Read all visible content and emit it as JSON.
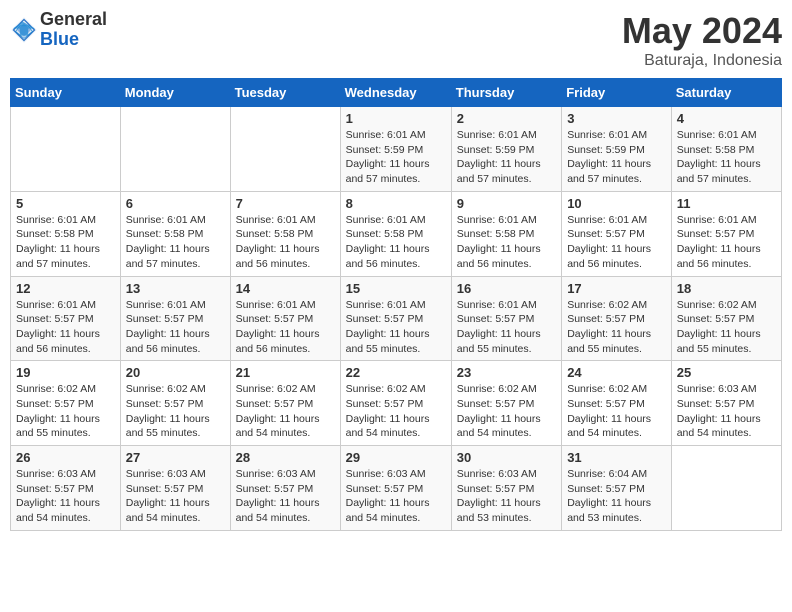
{
  "logo": {
    "general": "General",
    "blue": "Blue"
  },
  "title": "May 2024",
  "location": "Baturaja, Indonesia",
  "weekdays": [
    "Sunday",
    "Monday",
    "Tuesday",
    "Wednesday",
    "Thursday",
    "Friday",
    "Saturday"
  ],
  "weeks": [
    [
      {
        "day": "",
        "info": ""
      },
      {
        "day": "",
        "info": ""
      },
      {
        "day": "",
        "info": ""
      },
      {
        "day": "1",
        "info": "Sunrise: 6:01 AM\nSunset: 5:59 PM\nDaylight: 11 hours and 57 minutes."
      },
      {
        "day": "2",
        "info": "Sunrise: 6:01 AM\nSunset: 5:59 PM\nDaylight: 11 hours and 57 minutes."
      },
      {
        "day": "3",
        "info": "Sunrise: 6:01 AM\nSunset: 5:59 PM\nDaylight: 11 hours and 57 minutes."
      },
      {
        "day": "4",
        "info": "Sunrise: 6:01 AM\nSunset: 5:58 PM\nDaylight: 11 hours and 57 minutes."
      }
    ],
    [
      {
        "day": "5",
        "info": "Sunrise: 6:01 AM\nSunset: 5:58 PM\nDaylight: 11 hours and 57 minutes."
      },
      {
        "day": "6",
        "info": "Sunrise: 6:01 AM\nSunset: 5:58 PM\nDaylight: 11 hours and 57 minutes."
      },
      {
        "day": "7",
        "info": "Sunrise: 6:01 AM\nSunset: 5:58 PM\nDaylight: 11 hours and 56 minutes."
      },
      {
        "day": "8",
        "info": "Sunrise: 6:01 AM\nSunset: 5:58 PM\nDaylight: 11 hours and 56 minutes."
      },
      {
        "day": "9",
        "info": "Sunrise: 6:01 AM\nSunset: 5:58 PM\nDaylight: 11 hours and 56 minutes."
      },
      {
        "day": "10",
        "info": "Sunrise: 6:01 AM\nSunset: 5:57 PM\nDaylight: 11 hours and 56 minutes."
      },
      {
        "day": "11",
        "info": "Sunrise: 6:01 AM\nSunset: 5:57 PM\nDaylight: 11 hours and 56 minutes."
      }
    ],
    [
      {
        "day": "12",
        "info": "Sunrise: 6:01 AM\nSunset: 5:57 PM\nDaylight: 11 hours and 56 minutes."
      },
      {
        "day": "13",
        "info": "Sunrise: 6:01 AM\nSunset: 5:57 PM\nDaylight: 11 hours and 56 minutes."
      },
      {
        "day": "14",
        "info": "Sunrise: 6:01 AM\nSunset: 5:57 PM\nDaylight: 11 hours and 56 minutes."
      },
      {
        "day": "15",
        "info": "Sunrise: 6:01 AM\nSunset: 5:57 PM\nDaylight: 11 hours and 55 minutes."
      },
      {
        "day": "16",
        "info": "Sunrise: 6:01 AM\nSunset: 5:57 PM\nDaylight: 11 hours and 55 minutes."
      },
      {
        "day": "17",
        "info": "Sunrise: 6:02 AM\nSunset: 5:57 PM\nDaylight: 11 hours and 55 minutes."
      },
      {
        "day": "18",
        "info": "Sunrise: 6:02 AM\nSunset: 5:57 PM\nDaylight: 11 hours and 55 minutes."
      }
    ],
    [
      {
        "day": "19",
        "info": "Sunrise: 6:02 AM\nSunset: 5:57 PM\nDaylight: 11 hours and 55 minutes."
      },
      {
        "day": "20",
        "info": "Sunrise: 6:02 AM\nSunset: 5:57 PM\nDaylight: 11 hours and 55 minutes."
      },
      {
        "day": "21",
        "info": "Sunrise: 6:02 AM\nSunset: 5:57 PM\nDaylight: 11 hours and 54 minutes."
      },
      {
        "day": "22",
        "info": "Sunrise: 6:02 AM\nSunset: 5:57 PM\nDaylight: 11 hours and 54 minutes."
      },
      {
        "day": "23",
        "info": "Sunrise: 6:02 AM\nSunset: 5:57 PM\nDaylight: 11 hours and 54 minutes."
      },
      {
        "day": "24",
        "info": "Sunrise: 6:02 AM\nSunset: 5:57 PM\nDaylight: 11 hours and 54 minutes."
      },
      {
        "day": "25",
        "info": "Sunrise: 6:03 AM\nSunset: 5:57 PM\nDaylight: 11 hours and 54 minutes."
      }
    ],
    [
      {
        "day": "26",
        "info": "Sunrise: 6:03 AM\nSunset: 5:57 PM\nDaylight: 11 hours and 54 minutes."
      },
      {
        "day": "27",
        "info": "Sunrise: 6:03 AM\nSunset: 5:57 PM\nDaylight: 11 hours and 54 minutes."
      },
      {
        "day": "28",
        "info": "Sunrise: 6:03 AM\nSunset: 5:57 PM\nDaylight: 11 hours and 54 minutes."
      },
      {
        "day": "29",
        "info": "Sunrise: 6:03 AM\nSunset: 5:57 PM\nDaylight: 11 hours and 54 minutes."
      },
      {
        "day": "30",
        "info": "Sunrise: 6:03 AM\nSunset: 5:57 PM\nDaylight: 11 hours and 53 minutes."
      },
      {
        "day": "31",
        "info": "Sunrise: 6:04 AM\nSunset: 5:57 PM\nDaylight: 11 hours and 53 minutes."
      },
      {
        "day": "",
        "info": ""
      }
    ]
  ]
}
